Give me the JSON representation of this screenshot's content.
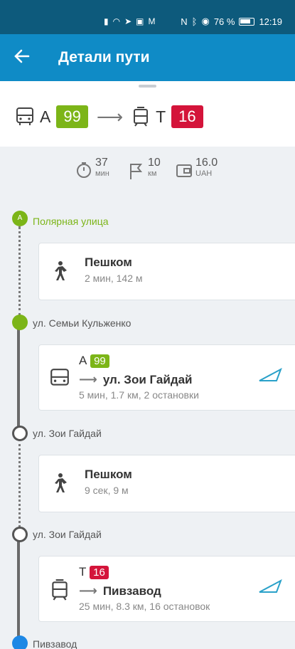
{
  "status": {
    "battery": "76 %",
    "time": "12:19"
  },
  "app": {
    "title": "Детали пути"
  },
  "summary": {
    "from_letter": "А",
    "from_route": "99",
    "to_letter": "Т",
    "to_route": "16",
    "time_value": "37",
    "time_unit": "мин",
    "distance_value": "10",
    "distance_unit": "км",
    "price_value": "16.0",
    "price_unit": "UAH"
  },
  "stops": [
    {
      "marker": "A",
      "name": "Полярная улица"
    },
    {
      "name": "ул. Семьи Кульженко"
    },
    {
      "name": "ул. Зои Гайдай"
    },
    {
      "name": "ул. Зои Гайдай"
    },
    {
      "name": "Пивзавод"
    }
  ],
  "legs": [
    {
      "type": "walk",
      "title": "Пешком",
      "sub": "2 мин, 142 м"
    },
    {
      "type": "bus",
      "letter": "А",
      "route": "99",
      "dest": "ул. Зои Гайдай",
      "sub": "5 мин, 1.7 км, 2 остановки"
    },
    {
      "type": "walk",
      "title": "Пешком",
      "sub": "9 сек, 9 м"
    },
    {
      "type": "tram",
      "letter": "Т",
      "route": "16",
      "dest": "Пивзавод",
      "sub": "25 мин, 8.3 км, 16 остановок"
    }
  ],
  "colors": {
    "statusbar": "#0d5a7c",
    "appbar": "#0f8bc6",
    "green": "#7cb518",
    "red": "#d4143a",
    "blue": "#1e88e5"
  }
}
